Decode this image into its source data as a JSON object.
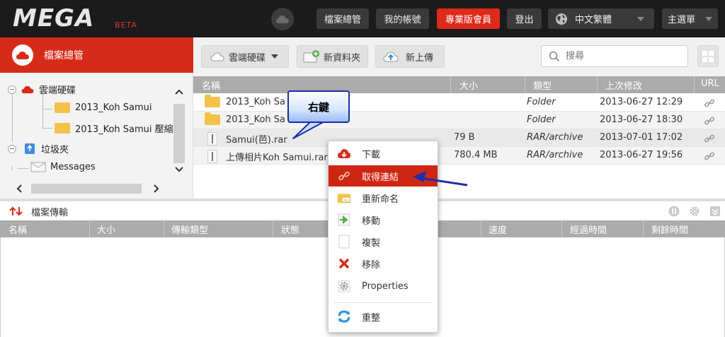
{
  "header": {
    "logo": "MEGA",
    "beta": "BETA",
    "nav": [
      "檔案總管",
      "我的帳號",
      "專業版會員",
      "登出"
    ],
    "language": "中文繁體",
    "main_menu": "主選單"
  },
  "sidebar": {
    "title": "檔案總管",
    "tree": [
      {
        "label": "雲端硬碟"
      },
      {
        "label": "2013_Koh Samui"
      },
      {
        "label": "2013_Koh Samui 壓縮"
      },
      {
        "label": "垃圾夾"
      },
      {
        "label": "Messages"
      }
    ]
  },
  "toolbar": {
    "cloud_drive": "雲端硬碟",
    "new_folder": "新資料夾",
    "upload": "新上傳",
    "search_placeholder": "搜尋"
  },
  "file_table": {
    "columns": [
      "名稱",
      "大小",
      "類型",
      "上次修改",
      "URL"
    ],
    "rows": [
      {
        "name": "2013_Koh Sa",
        "size": "",
        "type": "Folder",
        "modified": "2013-06-27 12:29"
      },
      {
        "name": "2013_Koh Sa",
        "size": "",
        "type": "Folder",
        "modified": "2013-06-27 18:30"
      },
      {
        "name": "Samui(芭).rar",
        "size": "79 B",
        "type": "RAR/archive",
        "modified": "2013-07-01 17:02"
      },
      {
        "name": "上傳相片Koh Samui.rar",
        "size": "780.4 MB",
        "type": "RAR/archive",
        "modified": "2013-06-27 19:56"
      }
    ]
  },
  "transfer": {
    "title": "檔案傳輸",
    "columns": [
      "名稱",
      "大小",
      "傳輸類型",
      "狀態",
      "速度",
      "經過時間",
      "剩餘時間"
    ]
  },
  "context_menu": {
    "items": [
      "下載",
      "取得連結",
      "重新命名",
      "移動",
      "複製",
      "移除",
      "Properties",
      "重整"
    ],
    "active_index": 1
  },
  "callout": {
    "text": "右鍵"
  },
  "colors": {
    "accent_red": "#d72b1a",
    "callout_border": "#1b2fa8"
  }
}
